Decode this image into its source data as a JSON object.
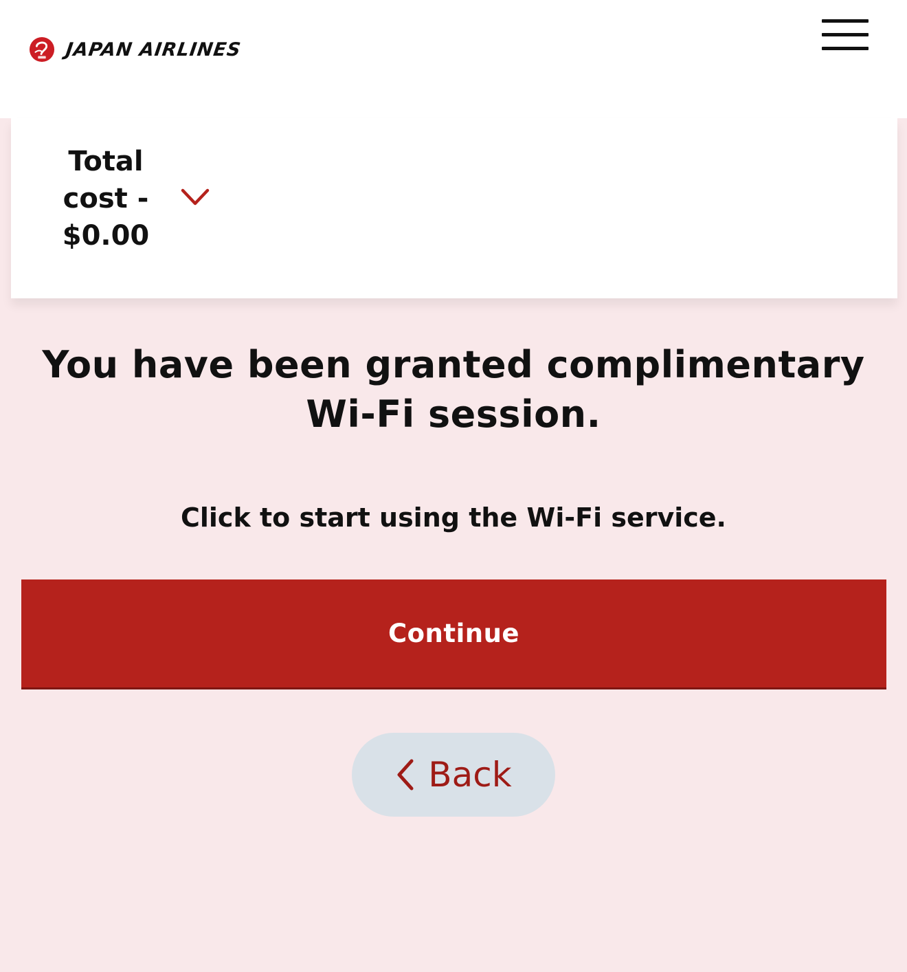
{
  "header": {
    "brand": "JAPAN AIRLINES",
    "logo_icon": "jal-tsurumaru-icon",
    "menu_icon": "hamburger-menu-icon"
  },
  "cost_summary": {
    "label": "Total cost - $0.00",
    "expand_icon": "chevron-down-icon"
  },
  "main": {
    "title": "You have been granted complimentary Wi-Fi session.",
    "instruction": "Click to start using the Wi-Fi service.",
    "continue_label": "Continue",
    "back_label": "Back",
    "back_icon": "chevron-left-icon"
  },
  "colors": {
    "brand_red": "#b5221c",
    "page_background": "#f9e8ea",
    "back_button_background": "#d9e1e8",
    "back_text": "#9e1b16"
  }
}
